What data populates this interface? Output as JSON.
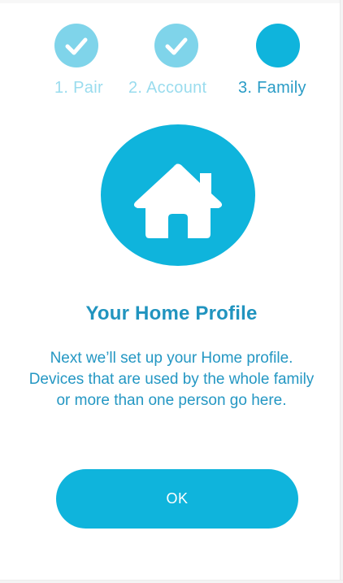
{
  "stepper": {
    "steps": [
      {
        "label": "1. Pair",
        "state": "done",
        "icon": "check-icon"
      },
      {
        "label": "2. Account",
        "state": "done",
        "icon": "check-icon"
      },
      {
        "label": "3. Family",
        "state": "active"
      }
    ]
  },
  "main": {
    "icon": "home-icon",
    "title": "Your Home Profile",
    "description": "Next we’ll set up your Home profile. Devices that are used by the whole family or more than one person go here.",
    "ok_label": "OK"
  },
  "colors": {
    "accent": "#0fb4dc",
    "completed_step": "#7fd4ea",
    "text": "#2194bf"
  }
}
